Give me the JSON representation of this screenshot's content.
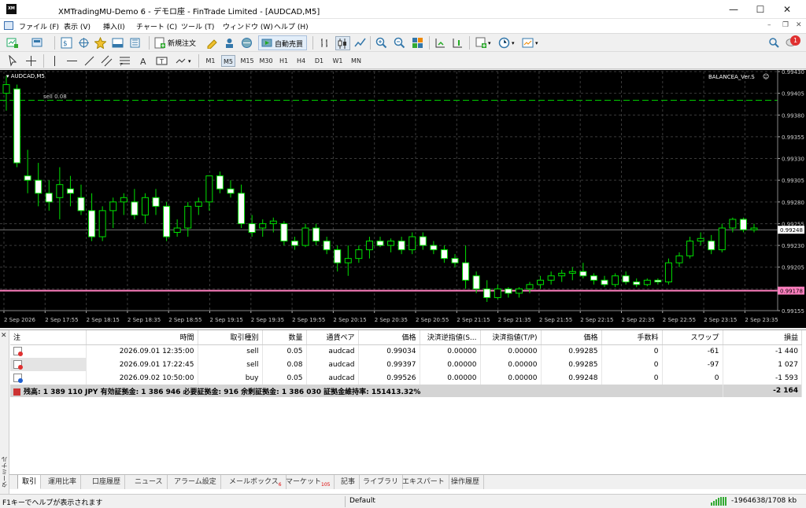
{
  "window": {
    "title": "XMTradingMU-Demo 6 - デモロ座 - FinTrade Limited - [AUDCAD,M5]",
    "app_icon": "XM"
  },
  "menu": {
    "items": [
      "ファイル (F)",
      "表示 (V)",
      "挿入(I)",
      "チャート (C)",
      "ツール (T)",
      "ウィンドウ (W)",
      "ヘルプ (H)"
    ],
    "notif_count": "1"
  },
  "toolbar": {
    "new_order": "新規注文",
    "auto_trade": "自動売買",
    "timeframes": [
      "M1",
      "M5",
      "M15",
      "M30",
      "H1",
      "H4",
      "D1",
      "W1",
      "MN"
    ],
    "selected_tf": "M5"
  },
  "chart": {
    "symbol": "AUDCAD,M5",
    "ea": "BALANCEA_Ver.S",
    "order_line": {
      "label": "sell 0.08",
      "price": 0.99397,
      "color": "#00cc00"
    },
    "bid_line": {
      "price": 0.99178,
      "label": "0.99178",
      "color": "#ff80c0"
    },
    "ask_line": {
      "price": 0.99248,
      "label": "0.99248"
    },
    "price_levels": [
      "0.99430",
      "0.99405",
      "0.99380",
      "0.99355",
      "0.99330",
      "0.99305",
      "0.99280",
      "0.99255",
      "0.99230",
      "0.99205",
      "0.99180",
      "0.99155"
    ],
    "time_labels": [
      "2 Sep 2026",
      "2 Sep 17:55",
      "2 Sep 18:15",
      "2 Sep 18:35",
      "2 Sep 18:55",
      "2 Sep 19:15",
      "2 Sep 19:35",
      "2 Sep 19:55",
      "2 Sep 20:15",
      "2 Sep 20:35",
      "2 Sep 20:55",
      "2 Sep 21:15",
      "2 Sep 21:35",
      "2 Sep 21:55",
      "2 Sep 22:15",
      "2 Sep 22:35",
      "2 Sep 22:55",
      "2 Sep 23:15",
      "2 Sep 23:35"
    ]
  },
  "chart_data": {
    "type": "candlestick",
    "ylim": [
      0.99155,
      0.9943
    ],
    "grid": true,
    "candles": [
      [
        0.99405,
        0.99425,
        0.99385,
        0.99415
      ],
      [
        0.9941,
        0.99415,
        0.9932,
        0.99325
      ],
      [
        0.9931,
        0.9934,
        0.9929,
        0.99305
      ],
      [
        0.99305,
        0.99325,
        0.99275,
        0.9929
      ],
      [
        0.9929,
        0.99305,
        0.9927,
        0.9928
      ],
      [
        0.99285,
        0.9932,
        0.9926,
        0.993
      ],
      [
        0.99295,
        0.9931,
        0.99275,
        0.9929
      ],
      [
        0.99285,
        0.993,
        0.99265,
        0.9927
      ],
      [
        0.9927,
        0.9929,
        0.99235,
        0.9924
      ],
      [
        0.9924,
        0.99275,
        0.99235,
        0.9927
      ],
      [
        0.9927,
        0.99285,
        0.9925,
        0.9928
      ],
      [
        0.9928,
        0.9929,
        0.99265,
        0.99285
      ],
      [
        0.9928,
        0.99295,
        0.9926,
        0.99265
      ],
      [
        0.99265,
        0.9929,
        0.99255,
        0.99285
      ],
      [
        0.99285,
        0.99295,
        0.99265,
        0.99275
      ],
      [
        0.99275,
        0.9928,
        0.99235,
        0.9924
      ],
      [
        0.99245,
        0.9926,
        0.9924,
        0.9925
      ],
      [
        0.9925,
        0.9928,
        0.9924,
        0.99275
      ],
      [
        0.99275,
        0.99285,
        0.99265,
        0.9928
      ],
      [
        0.9928,
        0.9931,
        0.9927,
        0.9931
      ],
      [
        0.9931,
        0.99315,
        0.9929,
        0.99295
      ],
      [
        0.99295,
        0.99305,
        0.99285,
        0.9929
      ],
      [
        0.9929,
        0.993,
        0.9925,
        0.99255
      ],
      [
        0.99255,
        0.99265,
        0.9924,
        0.99245
      ],
      [
        0.9925,
        0.9926,
        0.9924,
        0.99255
      ],
      [
        0.99255,
        0.99262,
        0.99245,
        0.99258
      ],
      [
        0.99255,
        0.99258,
        0.9923,
        0.99235
      ],
      [
        0.99235,
        0.9924,
        0.99225,
        0.9923
      ],
      [
        0.9923,
        0.99255,
        0.99228,
        0.9925
      ],
      [
        0.9925,
        0.99255,
        0.9923,
        0.99235
      ],
      [
        0.99235,
        0.9924,
        0.9922,
        0.99225
      ],
      [
        0.99225,
        0.9923,
        0.992,
        0.9921
      ],
      [
        0.9921,
        0.9923,
        0.99195,
        0.99215
      ],
      [
        0.99215,
        0.9923,
        0.9921,
        0.99225
      ],
      [
        0.99225,
        0.9924,
        0.99215,
        0.99235
      ],
      [
        0.99235,
        0.9924,
        0.99228,
        0.9923
      ],
      [
        0.9923,
        0.99238,
        0.99222,
        0.99235
      ],
      [
        0.99235,
        0.9924,
        0.9922,
        0.99225
      ],
      [
        0.99225,
        0.99245,
        0.9922,
        0.9924
      ],
      [
        0.9924,
        0.99245,
        0.99225,
        0.9923
      ],
      [
        0.9923,
        0.99235,
        0.9922,
        0.99225
      ],
      [
        0.99225,
        0.9923,
        0.9921,
        0.99215
      ],
      [
        0.99215,
        0.9922,
        0.99205,
        0.9921
      ],
      [
        0.9921,
        0.9923,
        0.9918,
        0.9919
      ],
      [
        0.99195,
        0.992,
        0.99175,
        0.9918
      ],
      [
        0.9918,
        0.9919,
        0.99165,
        0.9917
      ],
      [
        0.9917,
        0.99185,
        0.99168,
        0.9918
      ],
      [
        0.9918,
        0.99182,
        0.9917,
        0.99175
      ],
      [
        0.99175,
        0.99182,
        0.9917,
        0.9918
      ],
      [
        0.9918,
        0.99188,
        0.99175,
        0.99185
      ],
      [
        0.99185,
        0.99195,
        0.9918,
        0.9919
      ],
      [
        0.9919,
        0.992,
        0.99185,
        0.99195
      ],
      [
        0.99195,
        0.99202,
        0.99188,
        0.99198
      ],
      [
        0.99198,
        0.99205,
        0.9919,
        0.992
      ],
      [
        0.992,
        0.9921,
        0.99192,
        0.99195
      ],
      [
        0.99195,
        0.99198,
        0.99185,
        0.9919
      ],
      [
        0.9919,
        0.99195,
        0.99182,
        0.99185
      ],
      [
        0.99185,
        0.99198,
        0.99182,
        0.99195
      ],
      [
        0.99195,
        0.992,
        0.99185,
        0.99188
      ],
      [
        0.99188,
        0.99192,
        0.99182,
        0.99185
      ],
      [
        0.99185,
        0.99192,
        0.99183,
        0.9919
      ],
      [
        0.9919,
        0.99192,
        0.99185,
        0.99188
      ],
      [
        0.99188,
        0.99215,
        0.99185,
        0.9921
      ],
      [
        0.9921,
        0.99222,
        0.99205,
        0.99218
      ],
      [
        0.99218,
        0.9924,
        0.99215,
        0.99235
      ],
      [
        0.99235,
        0.99245,
        0.9923,
        0.99238
      ],
      [
        0.99235,
        0.99242,
        0.9922,
        0.99225
      ],
      [
        0.99225,
        0.99255,
        0.99222,
        0.9925
      ],
      [
        0.9925,
        0.99262,
        0.99245,
        0.9926
      ],
      [
        0.9926,
        0.99262,
        0.99245,
        0.99248
      ],
      [
        0.99248,
        0.99255,
        0.99245,
        0.9925
      ]
    ]
  },
  "orders": {
    "headers": [
      "注",
      "時間",
      "取引種別",
      "数量",
      "通貨ペア",
      "価格",
      "決済逆指値(S...",
      "決済指値(T/P)",
      "価格",
      "手数料",
      "スワップ",
      "損益"
    ],
    "rows": [
      {
        "type_color": "#e03030",
        "cells": [
          "",
          "2026.09.01 12:35:00",
          "sell",
          "0.05",
          "audcad",
          "0.99034",
          "0.00000",
          "0.00000",
          "0.99285",
          "0",
          "-61",
          "-1 440"
        ]
      },
      {
        "type_color": "#e03030",
        "cells": [
          "",
          "2026.09.01 17:22:45",
          "sell",
          "0.08",
          "audcad",
          "0.99397",
          "0.00000",
          "0.00000",
          "0.99285",
          "0",
          "-97",
          "1 027"
        ]
      },
      {
        "type_color": "#2060d0",
        "cells": [
          "",
          "2026.09.02 10:50:00",
          "buy",
          "0.05",
          "audcad",
          "0.99526",
          "0.00000",
          "0.00000",
          "0.99248",
          "0",
          "0",
          "-1 593"
        ]
      }
    ],
    "summary": "残高: 1 389 110 JPY  有効証拠金: 1 386 946  必要証拠金: 916  余剰証拠金: 1 386 030  証拠金維持率: 151413.32%",
    "summary_total": "-2 164"
  },
  "terminal": {
    "vertical_label": "ターミナル",
    "tabs": [
      {
        "label": "取引"
      },
      {
        "label": "運用比率"
      },
      {
        "label": "口座履歴"
      },
      {
        "label": "ニュース"
      },
      {
        "label": "アラーム設定"
      },
      {
        "label": "メールボックス",
        "badge": "6"
      },
      {
        "label": "マーケット",
        "badge": "105"
      },
      {
        "label": "記事"
      },
      {
        "label": "ライブラリ"
      },
      {
        "label": "エキスパート"
      },
      {
        "label": "操作履歴"
      }
    ]
  },
  "status": {
    "help": "F1キーでヘルプが表示されます",
    "profile": "Default",
    "traffic": "-1964638/1708 kb"
  }
}
